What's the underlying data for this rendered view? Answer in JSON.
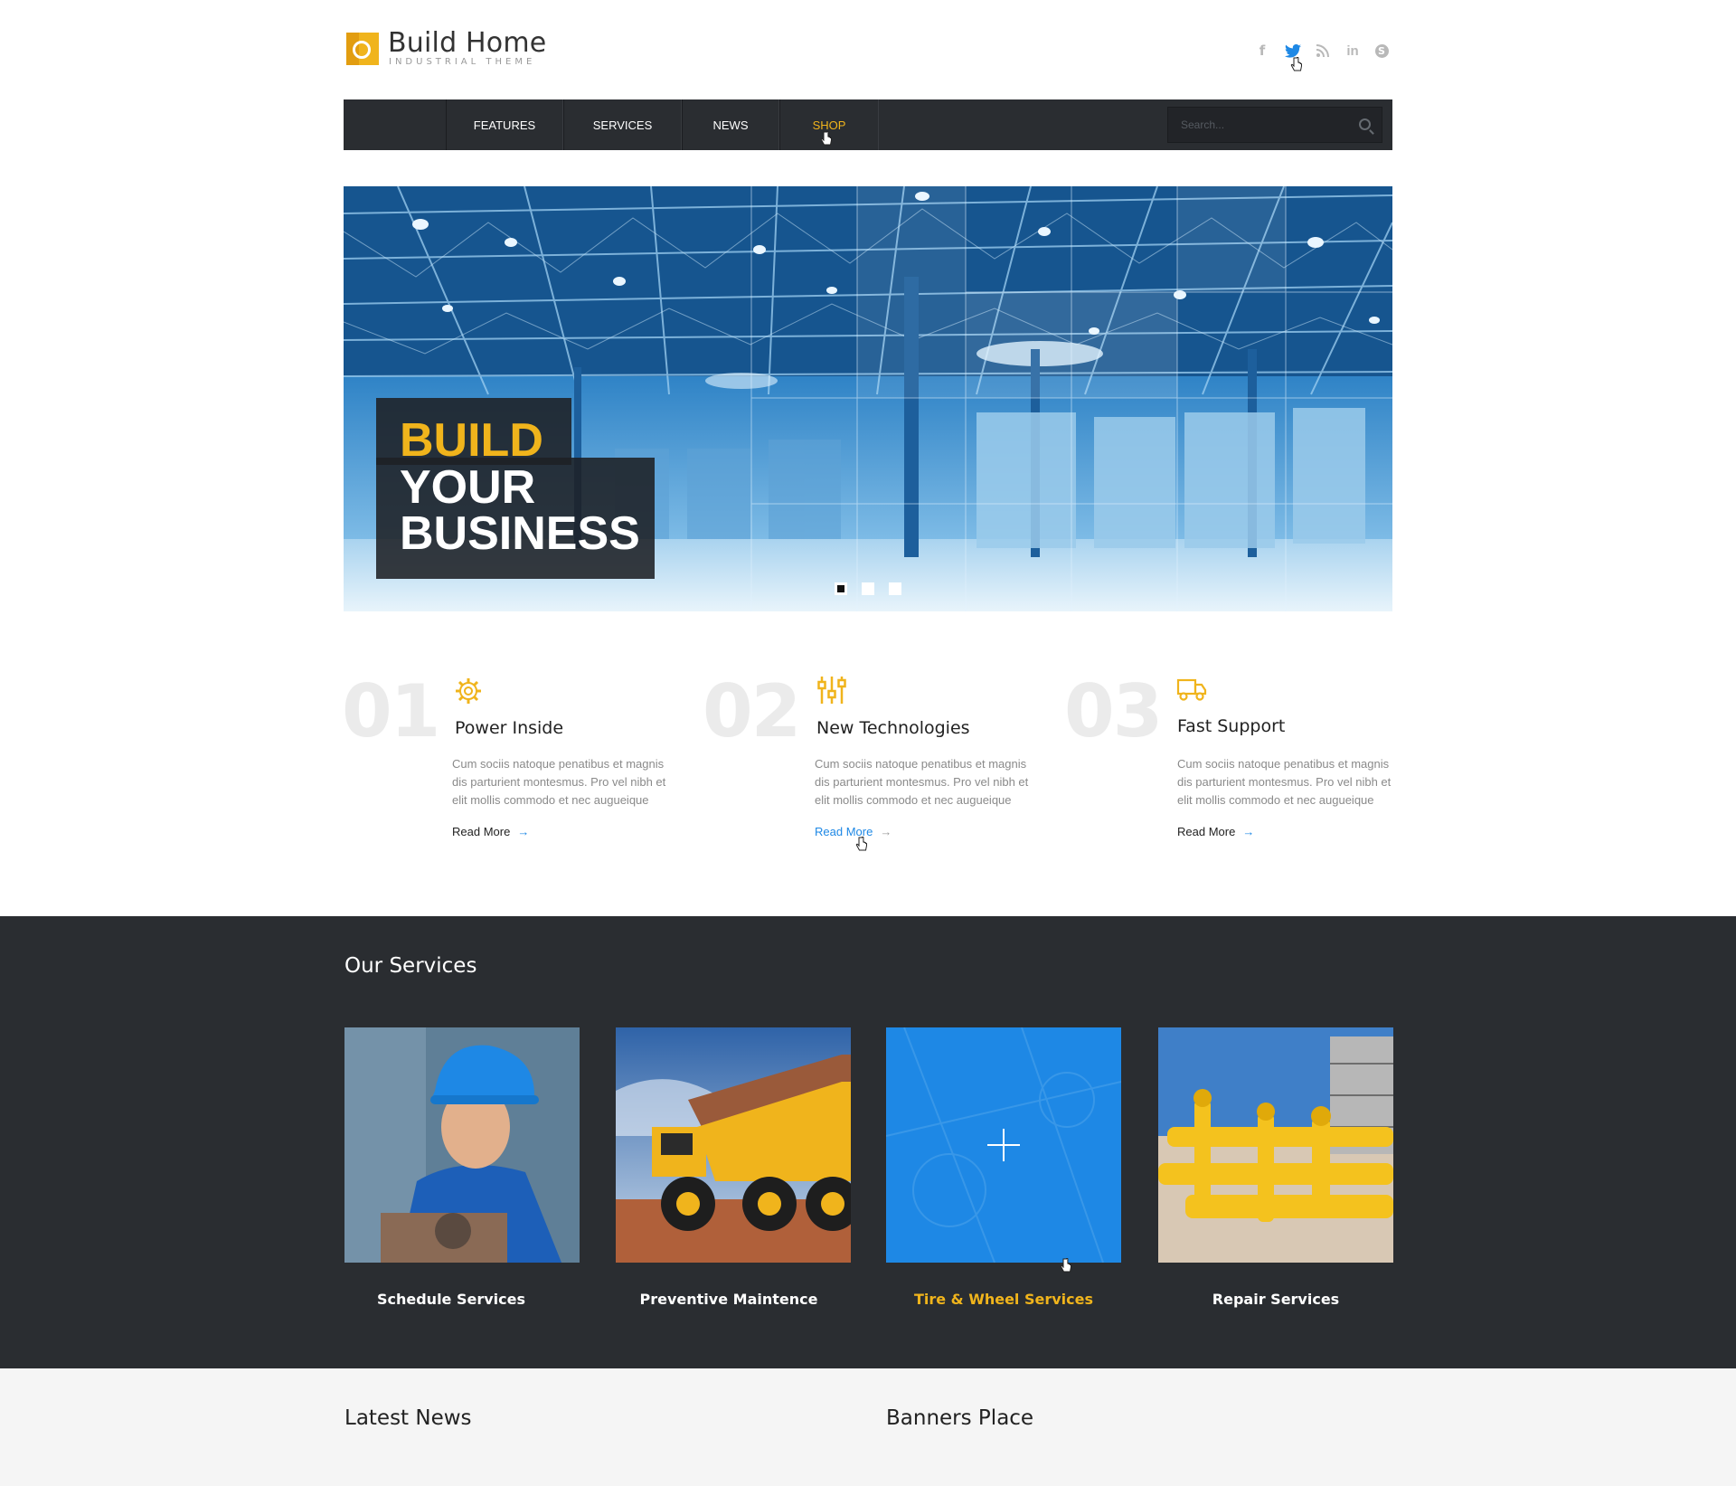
{
  "header": {
    "logo_title": "Build Home",
    "logo_subtitle": "INDUSTRIAL THEME",
    "social_icons": [
      "facebook-icon",
      "twitter-icon",
      "rss-icon",
      "linkedin-icon",
      "skype-icon"
    ],
    "social_glyphs": {
      "facebook": "f",
      "twitter": "t",
      "rss": "◠",
      "linkedin": "in",
      "skype": "S"
    }
  },
  "nav": {
    "items": [
      {
        "label": "FEATURES"
      },
      {
        "label": "SERVICES"
      },
      {
        "label": "NEWS"
      },
      {
        "label": "SHOP",
        "active": true
      }
    ],
    "search_placeholder": "Search..."
  },
  "hero": {
    "line1": "BUILD",
    "line2": "YOUR",
    "line3": "BUSINESS",
    "slide_count": 3,
    "active_slide": 1
  },
  "features": [
    {
      "num": "01",
      "icon": "gear-icon",
      "title": "Power Inside",
      "text": "Cum sociis natoque penatibus et magnis dis parturient montesmus. Pro vel nibh et elit mollis commodo et nec augueique",
      "link": "Read More"
    },
    {
      "num": "02",
      "icon": "sliders-icon",
      "title": "New Technologies",
      "text": "Cum sociis natoque penatibus et magnis dis parturient montesmus. Pro vel nibh et elit mollis commodo et nec augueique",
      "link": "Read More"
    },
    {
      "num": "03",
      "icon": "truck-icon",
      "title": "Fast Support",
      "text": "Cum sociis natoque penatibus et magnis dis parturient montesmus. Pro vel nibh et elit mollis commodo et nec augueique",
      "link": "Read More"
    }
  ],
  "services": {
    "title": "Our Services",
    "items": [
      {
        "label": "Schedule Services"
      },
      {
        "label": "Preventive Maintence"
      },
      {
        "label": "Tire & Wheel Services",
        "active": true
      },
      {
        "label": "Repair Services"
      }
    ]
  },
  "bottom": {
    "latest_news": "Latest News",
    "banners": "Banners Place"
  },
  "colors": {
    "accent": "#f0b41c",
    "link_blue": "#1e88e5",
    "dark_bg": "#2a2d31"
  }
}
